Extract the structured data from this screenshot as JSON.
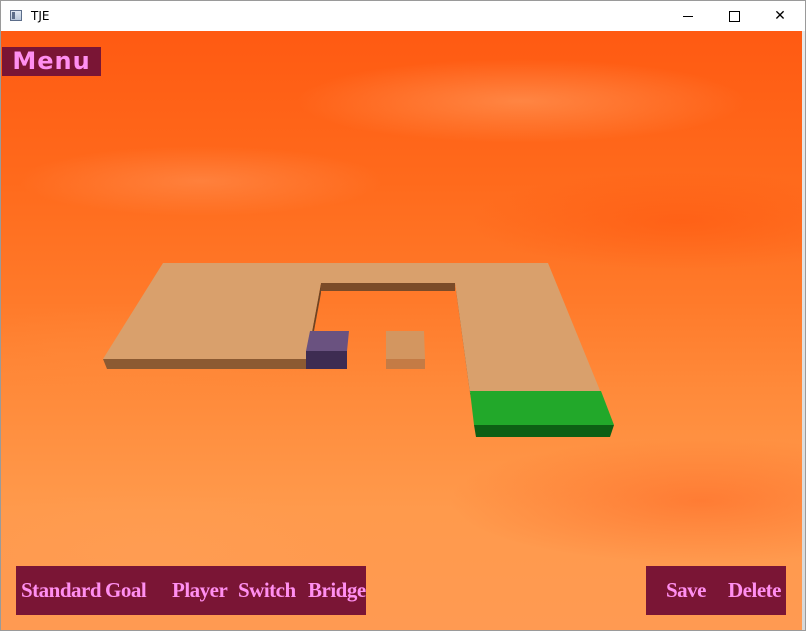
{
  "window": {
    "title": "TJE",
    "controls": {
      "minimize_icon": "minimize-icon",
      "maximize_icon": "maximize-icon",
      "close_glyph": "✕"
    }
  },
  "game": {
    "menu_label": "Menu",
    "toolbar_left": {
      "standard": "Standard",
      "goal": "Goal",
      "player": "Player",
      "switch": "Switch",
      "bridge": "Bridge"
    },
    "toolbar_right": {
      "save": "Save",
      "delete": "Delete"
    }
  },
  "colors": {
    "button_bg": "#7a1535",
    "button_text": "#ff8ff0",
    "tile_top": "#d9a06c",
    "tile_side": "#8c5a32",
    "goal_top": "#22a82a",
    "goal_side": "#0d5f14",
    "player_top": "#6a5280",
    "player_side": "#3e2c52",
    "sky": "#ff6a1c"
  }
}
